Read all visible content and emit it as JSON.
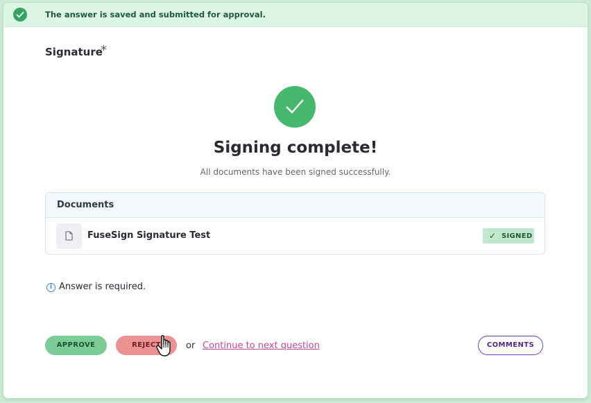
{
  "banner": {
    "message": "The answer is saved and submitted for approval.",
    "icon": "check-circle-icon",
    "color": "#35a463"
  },
  "question": {
    "label": "Signature",
    "required_mark": "*"
  },
  "status": {
    "icon": "check-circle-icon",
    "title": "Signing complete!",
    "subtitle": "All documents have been signed successfully."
  },
  "documents": {
    "header": "Documents",
    "items": [
      {
        "name": "FuseSign Signature Test",
        "icon": "file-icon",
        "status": "SIGNED",
        "status_icon": "check-icon"
      }
    ]
  },
  "validation": {
    "message": "Answer is required.",
    "icon": "info-icon"
  },
  "actions": {
    "approve_label": "APPROVE",
    "reject_label": "REJECT",
    "or_text": "or",
    "continue_label": "Continue to next question",
    "comments_label": "COMMENTS"
  },
  "colors": {
    "success": "#46b86e",
    "approve": "#7ccc97",
    "reject": "#ec9293",
    "link": "#c2489a",
    "comments_border": "#6b3bb5"
  }
}
